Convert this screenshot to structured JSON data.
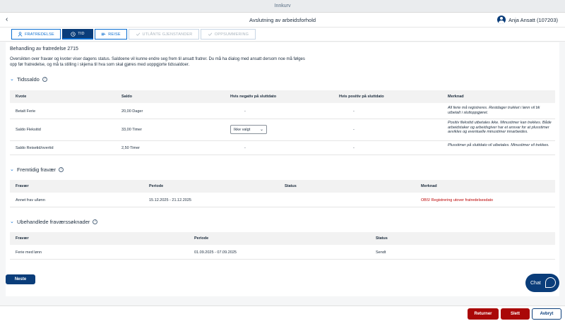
{
  "shell": {
    "title": "Innkurv"
  },
  "header": {
    "title": "Avslutning av arbeidsforhold",
    "user": "Anja Ansatt (107203)"
  },
  "tabs": [
    {
      "label": "Fratredelse",
      "icon": "person-icon"
    },
    {
      "label": "Tid",
      "icon": "clock-icon"
    },
    {
      "label": "Reise",
      "icon": "travel-icon"
    },
    {
      "label": "Utlånte gjenstander",
      "icon": "check-icon"
    },
    {
      "label": "Oppsummering",
      "icon": "check-icon"
    }
  ],
  "page": {
    "title": "Behandling av fratredelse 2715",
    "intro": "Oversikten over fravær og kvoter viser dagens status. Saldoene vil kunne endre seg frem til ansatt fratrer. Du må ha dialog med ansatt dersom noe må følges opp før fratredelse, og må ta stilling i skjema til hva som skal gjøres med uoppgjorte tidssaldoer."
  },
  "tidssaldo": {
    "title": "Tidssaldo",
    "columns": [
      "Kvote",
      "Saldo",
      "Hvis negativ på sluttdato",
      "Hvis positiv på sluttdato",
      "Merknad"
    ],
    "rows": [
      {
        "kvote": "Betalt Ferie",
        "saldo": "20,00 Dager",
        "negativ": "-",
        "positiv": "-",
        "merknad": "All ferie må registreres. Restdager trukket i lønn vil bli utbetalt i sluttoppgjøret."
      },
      {
        "kvote": "Saldo Fleksitid",
        "saldo": "33,00 Timer",
        "negativ": "Ikke valgt",
        "positiv": "-",
        "merknad": "Positiv fleksitid utbetales ikke. Minustimer kan trekkes. Både arbeidstaker og arbeidsgiver har et ansvar for at plusstimer avvikles og eventuelle minustimer innarbeides."
      },
      {
        "kvote": "Saldo Reisetid/overtid",
        "saldo": "2,50 Timer",
        "negativ": "-",
        "positiv": "-",
        "merknad": "Plusstimer på sluttdato vil utbetales. Minustimer vil trekkes."
      }
    ]
  },
  "fremtidig": {
    "title": "Fremtidig fravær",
    "columns": [
      "Fravær",
      "Periode",
      "Status",
      "Merknad"
    ],
    "rows": [
      {
        "fravaer": "Annet frav u/lønn",
        "periode": "15.12.2025 - 21.12.2025",
        "status": "",
        "merknad": "OBS! Registrering utover fratredelsesdato"
      }
    ]
  },
  "ubehandlede": {
    "title": "Ubehandlede fraværssøknader",
    "columns": [
      "Fravær",
      "Periode",
      "Status"
    ],
    "rows": [
      {
        "fravaer": "Ferie med lønn",
        "periode": "01.09.2025 - 07.09.2025",
        "status": "Sendt"
      }
    ]
  },
  "buttons": {
    "neste": "Neste",
    "returner": "Returner",
    "slett": "Slett",
    "avbryt": "Avbryt"
  },
  "chat": {
    "label": "Chat"
  }
}
